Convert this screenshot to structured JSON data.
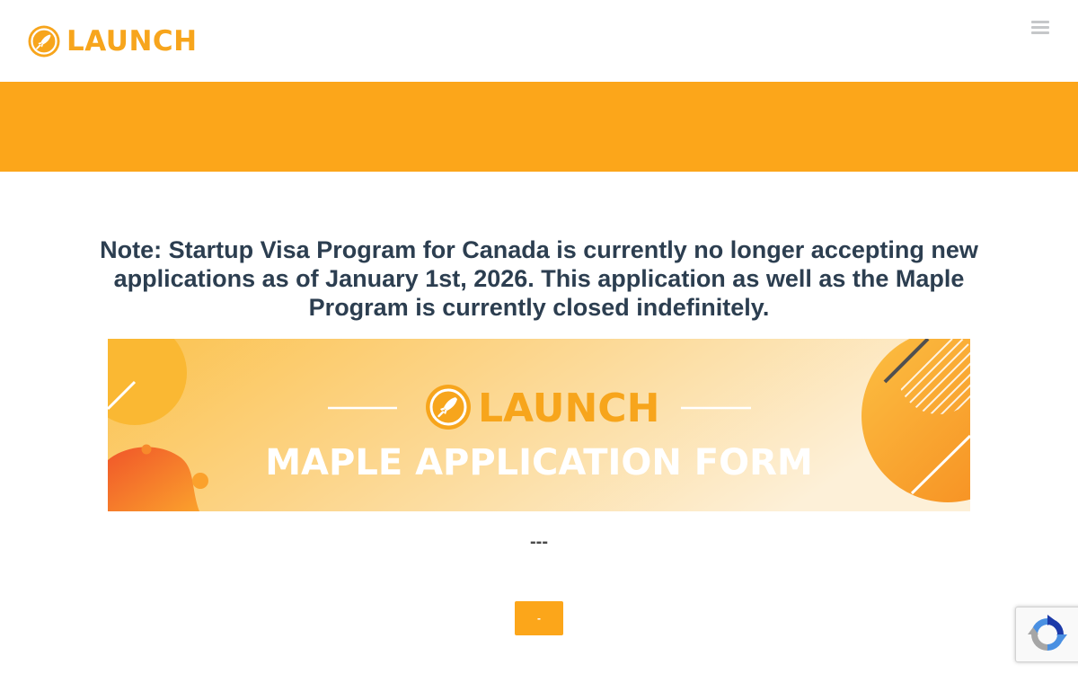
{
  "header": {
    "logo_text": "LAUNCH",
    "logo_icon": "rocket-icon",
    "menu_icon": "hamburger-menu-icon"
  },
  "colors": {
    "brand_orange": "#fca61a",
    "logo_orange": "#f7a51c",
    "heading_text": "#2c3e50"
  },
  "notice": {
    "text": "Note: Startup Visa Program for Canada is currently no longer accepting new applications as of January 1st, 2026. This application as well as the Maple Program is currently closed indefinitely."
  },
  "banner": {
    "logo_text": "LAUNCH",
    "title": "MAPLE APPLICATION FORM"
  },
  "separator": {
    "text": "---"
  },
  "submit_button": {
    "label": "-"
  },
  "recaptcha": {
    "icon": "recaptcha-icon"
  }
}
